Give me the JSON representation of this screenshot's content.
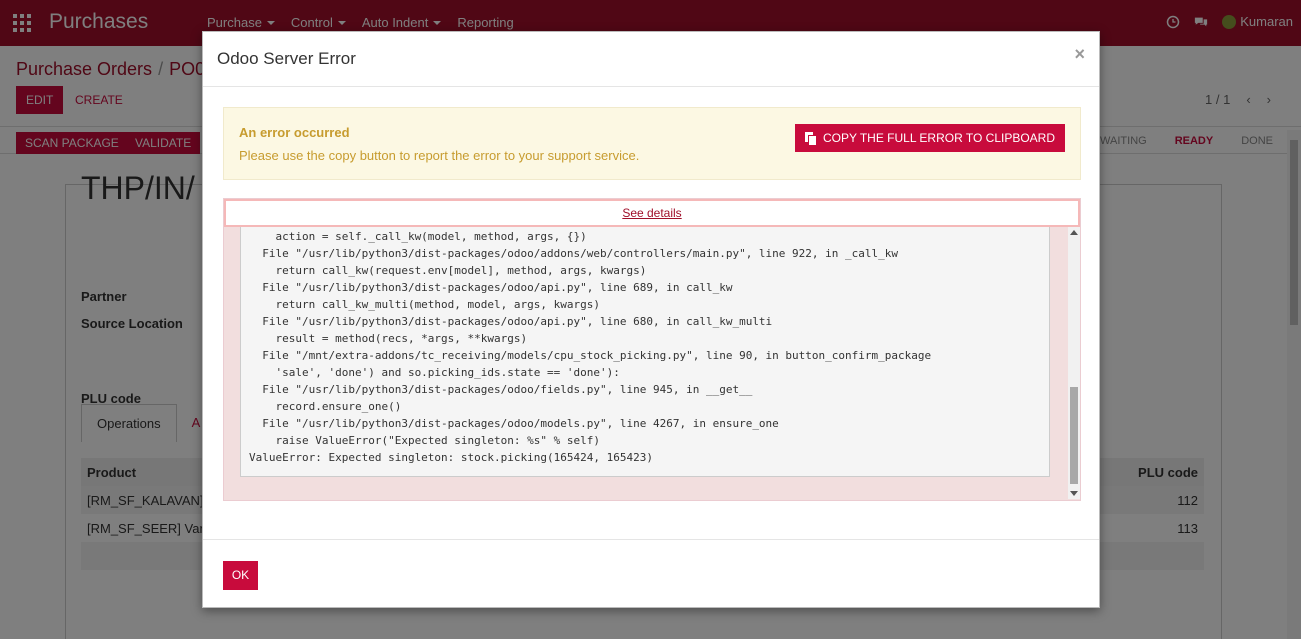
{
  "navbar": {
    "brand": "Purchases",
    "menu": [
      {
        "label": "Purchase",
        "dropdown": true
      },
      {
        "label": "Control",
        "dropdown": true
      },
      {
        "label": "Auto Indent",
        "dropdown": true
      },
      {
        "label": "Reporting",
        "dropdown": false
      }
    ],
    "user_name": "Kumaran",
    "icons": [
      "apps-grid-icon",
      "clock-icon",
      "chat-icon"
    ]
  },
  "page": {
    "breadcrumb_root": "Purchase Orders",
    "breadcrumb_current": "PO0",
    "edit_label": "EDIT",
    "create_label": "CREATE",
    "pager": "1 / 1",
    "scan_package_label": "SCAN PACKAGE",
    "validate_label": "VALIDATE",
    "status_waiting": "WAITING",
    "status_ready": "READY",
    "status_done": "DONE",
    "record_title": "THP/IN/",
    "field_partner": "Partner",
    "field_source_location": "Source Location",
    "field_plu_code": "PLU code",
    "tab_operations": "Operations",
    "tab_second": "A",
    "table": {
      "col_product": "Product",
      "col_plu": "PLU code",
      "rows": [
        {
          "product": "[RM_SF_KALAVAN] (",
          "plu": "112"
        },
        {
          "product": "[RM_SF_SEER] Vanja",
          "plu": "113"
        }
      ]
    }
  },
  "modal": {
    "title": "Odoo Server Error",
    "close_symbol": "×",
    "alert_title": "An error occurred",
    "alert_message": "Please use the copy button to report the error to your support service.",
    "copy_button_label": "COPY THE FULL ERROR TO CLIPBOARD",
    "see_details_label": "See details",
    "traceback": "    action = self._call_kw(model, method, args, {})\n  File \"/usr/lib/python3/dist-packages/odoo/addons/web/controllers/main.py\", line 922, in _call_kw\n    return call_kw(request.env[model], method, args, kwargs)\n  File \"/usr/lib/python3/dist-packages/odoo/api.py\", line 689, in call_kw\n    return call_kw_multi(method, model, args, kwargs)\n  File \"/usr/lib/python3/dist-packages/odoo/api.py\", line 680, in call_kw_multi\n    result = method(recs, *args, **kwargs)\n  File \"/mnt/extra-addons/tc_receiving/models/cpu_stock_picking.py\", line 90, in button_confirm_package\n    'sale', 'done') and so.picking_ids.state == 'done'):\n  File \"/usr/lib/python3/dist-packages/odoo/fields.py\", line 945, in __get__\n    record.ensure_one()\n  File \"/usr/lib/python3/dist-packages/odoo/models.py\", line 4267, in ensure_one\n    raise ValueError(\"Expected singleton: %s\" % self)\nValueError: Expected singleton: stock.picking(165424, 165423)",
    "ok_label": "OK"
  },
  "colors": {
    "brand": "#a00f2a",
    "primary_button": "#c80b3c",
    "alert_bg": "#fcf8e3",
    "alert_text": "#c79c2f",
    "error_bg": "#f2dede"
  }
}
